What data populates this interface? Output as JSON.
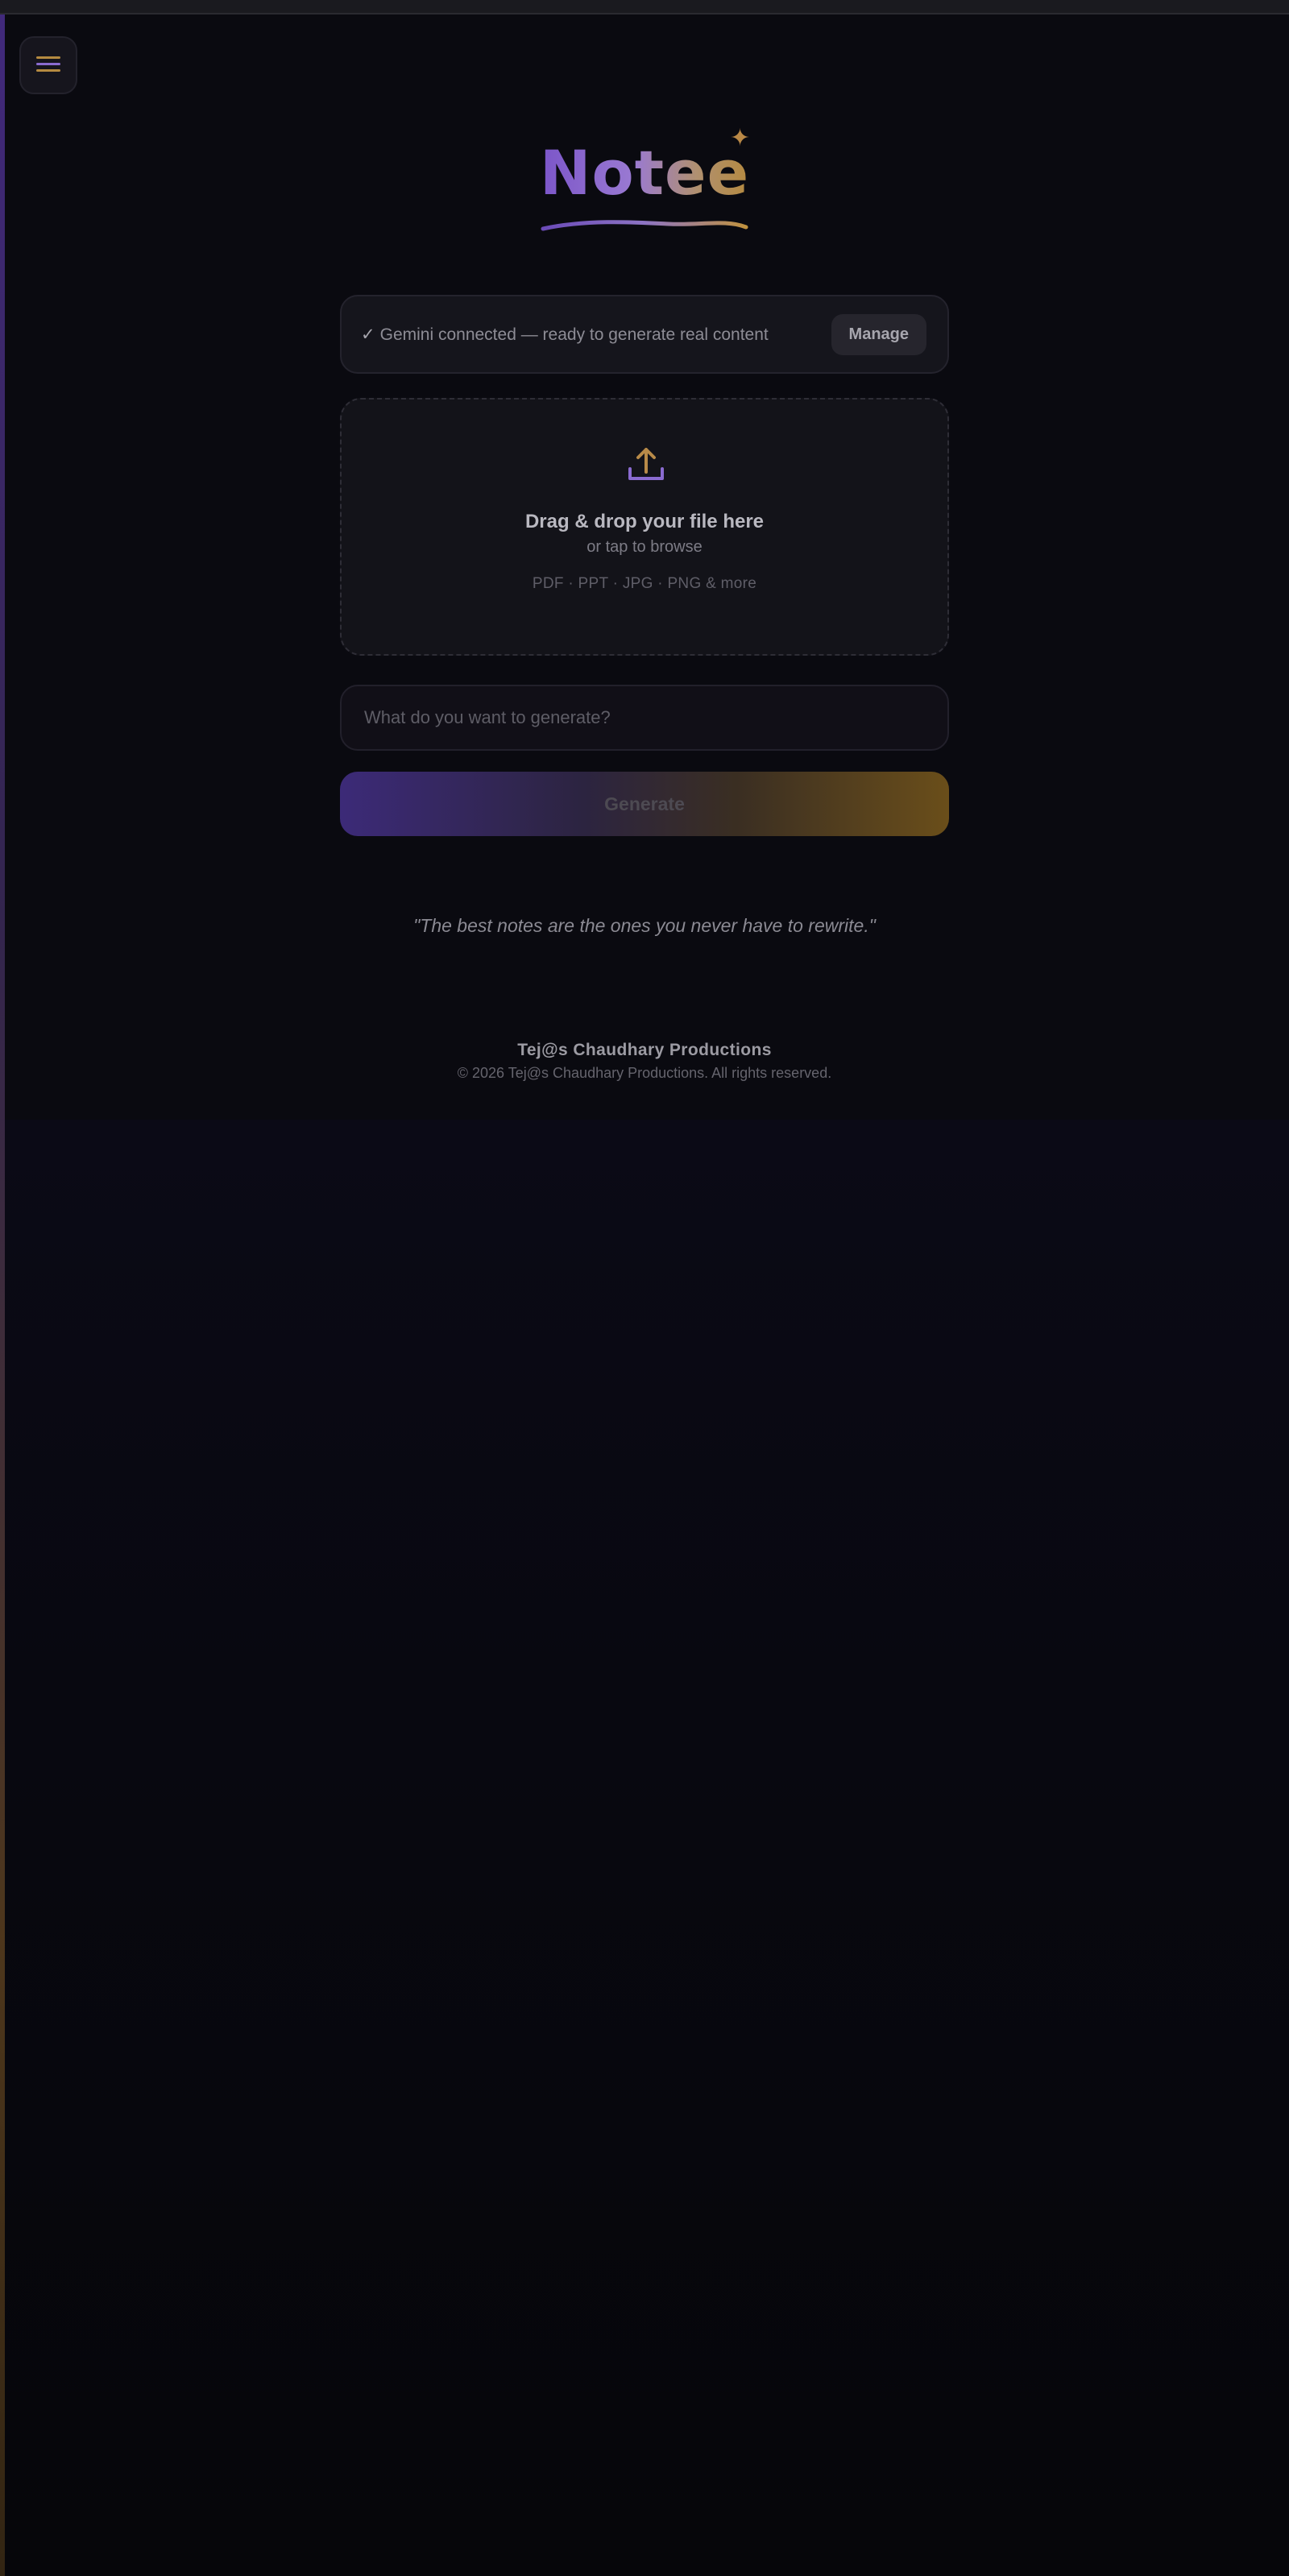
{
  "brand": {
    "title": "Notee",
    "sparkle_icon": "sparkle-icon",
    "accent_colors": [
      "#7b55c9",
      "#b58a40"
    ]
  },
  "menu": {
    "icon": "hamburger-menu-icon"
  },
  "status": {
    "check": "✓",
    "text": "Gemini connected — ready to generate real content",
    "manage_label": "Manage"
  },
  "upload": {
    "icon": "upload-icon",
    "title": "Drag & drop your file here",
    "subtitle": "or tap to browse",
    "formats": "PDF · PPT · JPG · PNG & more"
  },
  "prompt": {
    "value": "",
    "placeholder": "What do you want to generate?"
  },
  "generate": {
    "label": "Generate"
  },
  "quote": "\"The best notes are the ones you never have to rewrite.\"",
  "footer": {
    "title": "Tej@s Chaudhary Productions",
    "copyright": "© 2026 Tej@s Chaudhary Productions. All rights reserved."
  }
}
